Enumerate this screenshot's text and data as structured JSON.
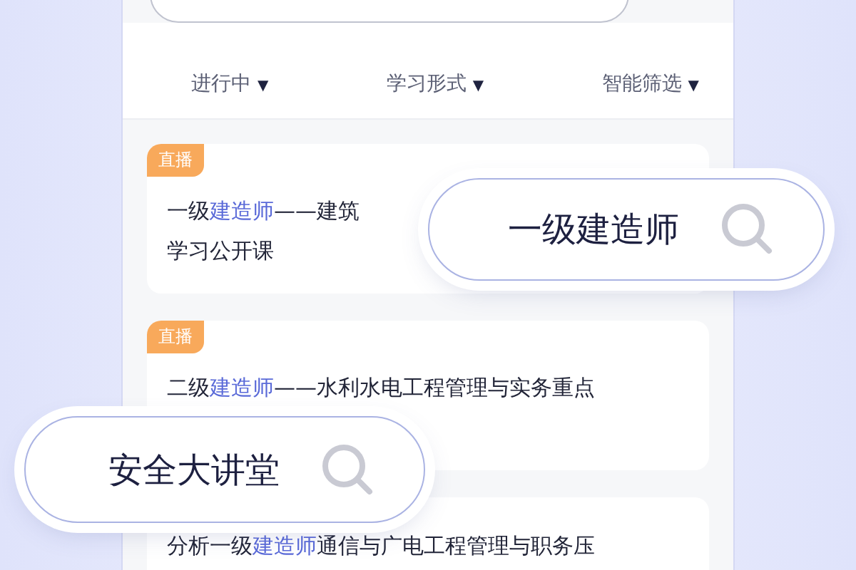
{
  "filters": [
    {
      "label": "进行中",
      "arrow": "▼"
    },
    {
      "label": "学习形式",
      "arrow": "▼"
    },
    {
      "label": "智能筛选",
      "arrow": "▼"
    }
  ],
  "cards": [
    {
      "tag": "直播",
      "lines": [
        [
          {
            "text": "一级",
            "highlight": false
          },
          {
            "text": "建造师",
            "highlight": true
          },
          {
            "text": "——建筑",
            "highlight": false
          }
        ],
        [
          {
            "text": "学习公开课",
            "highlight": false
          }
        ]
      ]
    },
    {
      "tag": "直播",
      "lines": [
        [
          {
            "text": "二级",
            "highlight": false
          },
          {
            "text": "建造师",
            "highlight": true
          },
          {
            "text": "——水利水电工程管理与实务重点",
            "highlight": false
          }
        ]
      ]
    },
    {
      "lines": [
        [
          {
            "text": "分析一级",
            "highlight": false
          },
          {
            "text": "建造师",
            "highlight": true
          },
          {
            "text": "通信与广电工程管理与职务压",
            "highlight": false
          }
        ]
      ]
    }
  ],
  "search_bubbles": [
    {
      "query": "一级建造师"
    },
    {
      "query": "安全大讲堂"
    }
  ]
}
